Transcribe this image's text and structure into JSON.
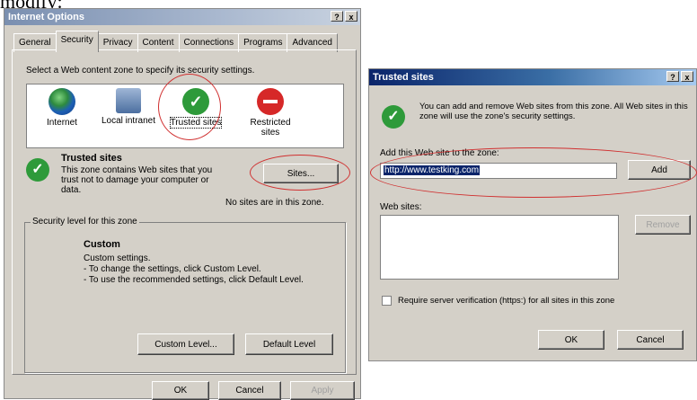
{
  "top_text": "modify:",
  "io": {
    "title": "Internet Options",
    "title_buttons": [
      "?",
      "x"
    ],
    "tabs": [
      "General",
      "Security",
      "Privacy",
      "Content",
      "Connections",
      "Programs",
      "Advanced"
    ],
    "active_tab": "Security",
    "select_zone_text": "Select a Web content zone to specify its security settings.",
    "zones": [
      {
        "label": "Internet",
        "icon": "globe-icon"
      },
      {
        "label": "Local intranet",
        "icon": "intranet-icon"
      },
      {
        "label": "Trusted sites",
        "icon": "check-icon"
      },
      {
        "label": "Restricted sites",
        "icon": "restricted-icon"
      }
    ],
    "zone_heading": "Trusted sites",
    "zone_desc": "This zone contains Web sites that you trust not to damage your computer or data.",
    "sites_button": "Sites...",
    "no_sites_text": "No sites are in this zone.",
    "security_level_title": "Security level for this zone",
    "level_name": "Custom",
    "level_lines": [
      "Custom settings.",
      "- To change the settings, click Custom Level.",
      "- To use the recommended settings, click Default Level."
    ],
    "custom_level_button": "Custom Level...",
    "default_level_button": "Default Level",
    "ok_button": "OK",
    "cancel_button": "Cancel",
    "apply_button": "Apply"
  },
  "ts": {
    "title": "Trusted sites",
    "title_buttons": [
      "?",
      "x"
    ],
    "intro_text": "You can add and remove Web sites from this zone. All Web sites in this zone will use the zone's security settings.",
    "add_label": "Add this Web site to the zone:",
    "add_value": "http://www.testking.com",
    "add_button": "Add",
    "websites_label": "Web sites:",
    "remove_button": "Remove",
    "require_verification": "Require server verification (https:) for all sites in this zone",
    "require_checked": false,
    "ok_button": "OK",
    "cancel_button": "Cancel"
  },
  "colors": {
    "annotation_red": "#d03030",
    "check_green": "#2e9a3a",
    "dialog_gray": "#d4d0c8"
  }
}
